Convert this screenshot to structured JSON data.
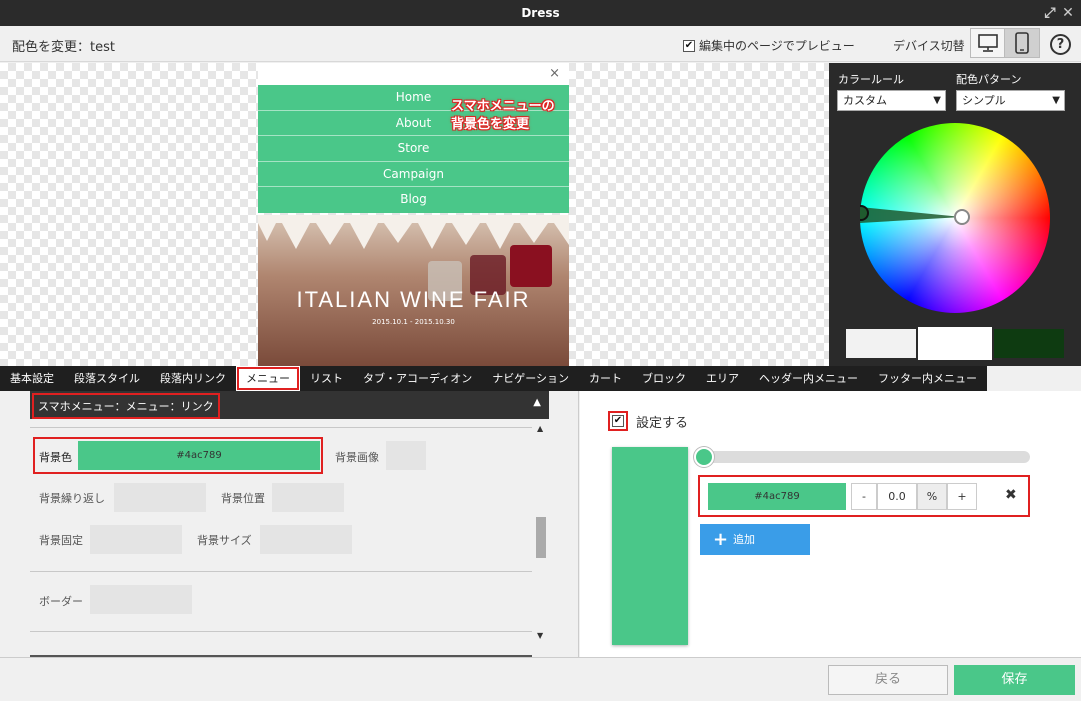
{
  "window": {
    "title": "Dress"
  },
  "header": {
    "title": "配色を変更：test",
    "preview_checkbox_label": "編集中のページでプレビュー",
    "preview_checked": true,
    "device_label": "デバイス切替",
    "help_glyph": "?"
  },
  "preview": {
    "menu_items": [
      "Home",
      "About",
      "Store",
      "Campaign",
      "Blog"
    ],
    "close_glyph": "×",
    "callout_line1": "スマホメニューの",
    "callout_line2": "背景色を変更",
    "hero_title": "ITALIAN WINE FAIR",
    "hero_date": "2015.10.1 - 2015.10.30",
    "menu_bg_color": "#4ac789"
  },
  "color_panel": {
    "rule_label": "カラールール",
    "rule_value": "カスタム",
    "pattern_label": "配色パターン",
    "pattern_value": "シンプル",
    "swatches": [
      "#f2f2f2",
      "#ffffff",
      "#0e3b11"
    ]
  },
  "tabs": [
    "基本設定",
    "段落スタイル",
    "段落内リンク",
    "メニュー",
    "リスト",
    "タブ・アコーディオン",
    "ナビゲーション",
    "カート",
    "ブロック",
    "エリア",
    "ヘッダー内メニュー",
    "フッター内メニュー"
  ],
  "active_tab": "メニュー",
  "left_panel": {
    "section_title": "スマホメニュー：メニュー：リンク",
    "fields": {
      "bg_color_label": "背景色",
      "bg_color_value": "#4ac789",
      "bg_image_label": "背景画像",
      "bg_repeat_label": "背景繰り返し",
      "bg_position_label": "背景位置",
      "bg_fixed_label": "背景固定",
      "bg_size_label": "背景サイズ",
      "border_label": "ボーダー"
    }
  },
  "right_panel": {
    "enable_label": "設定する",
    "enable_checked": true,
    "stop_color": "#4ac789",
    "minus": "-",
    "position_value": "0.0",
    "unit": "%",
    "plus": "+",
    "add_label": "追加"
  },
  "footer": {
    "back_label": "戻る",
    "save_label": "保存"
  }
}
